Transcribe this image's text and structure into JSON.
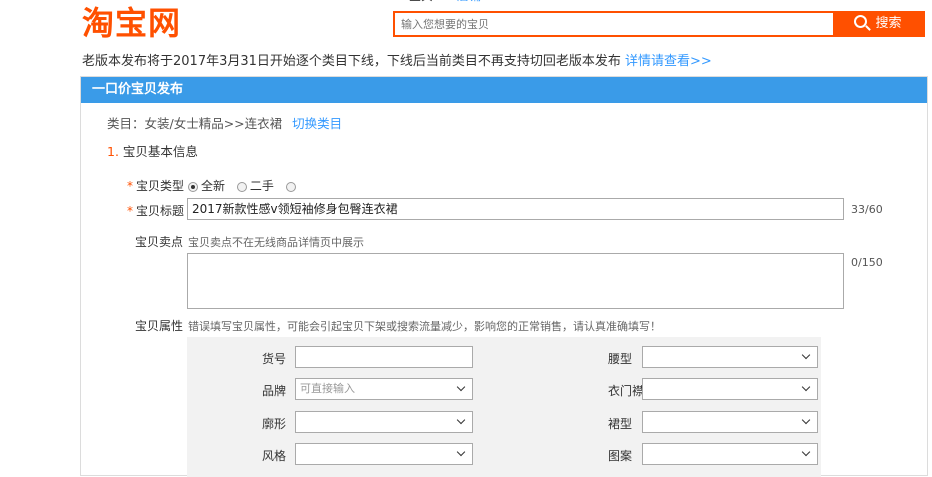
{
  "header": {
    "logo": "淘宝网",
    "tabs": [
      "宝贝",
      "店铺"
    ],
    "search": {
      "placeholder": "输入您想要的宝贝",
      "button": "搜索"
    },
    "accent": "#ff5000"
  },
  "notice": {
    "text": "老版本发布将于2017年3月31日开始逐个类目下线，下线后当前类目不再支持切回老版本发布 ",
    "link": "详情请查看>>"
  },
  "panel": {
    "title": "一口价宝贝发布",
    "header_color": "#3a9be8",
    "category": {
      "text": "类目：女装/女士精品>>连衣裙",
      "switch": "切换类目"
    },
    "section": {
      "num": "1.",
      "label": "宝贝基本信息"
    }
  },
  "form": {
    "type": {
      "label": "宝贝类型",
      "options": [
        "全新",
        "二手",
        ""
      ],
      "selected": "全新"
    },
    "title": {
      "label": "宝贝标题",
      "value": "2017新款性感v领短袖修身包臀连衣裙",
      "counter": "33/60"
    },
    "selling_point": {
      "label": "宝贝卖点",
      "hint": "宝贝卖点不在无线商品详情页中展示",
      "counter": "0/150"
    },
    "attributes": {
      "label": "宝贝属性",
      "hint": "错误填写宝贝属性，可能会引起宝贝下架或搜索流量减少，影响您的正常销售，请认真准确填写！",
      "fields": [
        {
          "label": "货号",
          "value": "",
          "type": "text"
        },
        {
          "label": "腰型",
          "value": "",
          "type": "select"
        },
        {
          "label": "品牌",
          "value": "可直接输入",
          "type": "select"
        },
        {
          "label": "衣门襟",
          "value": "",
          "type": "select"
        },
        {
          "label": "廓形",
          "value": "",
          "type": "select"
        },
        {
          "label": "裙型",
          "value": "",
          "type": "select"
        },
        {
          "label": "风格",
          "value": "",
          "type": "select"
        },
        {
          "label": "图案",
          "value": "",
          "type": "select"
        }
      ]
    }
  }
}
